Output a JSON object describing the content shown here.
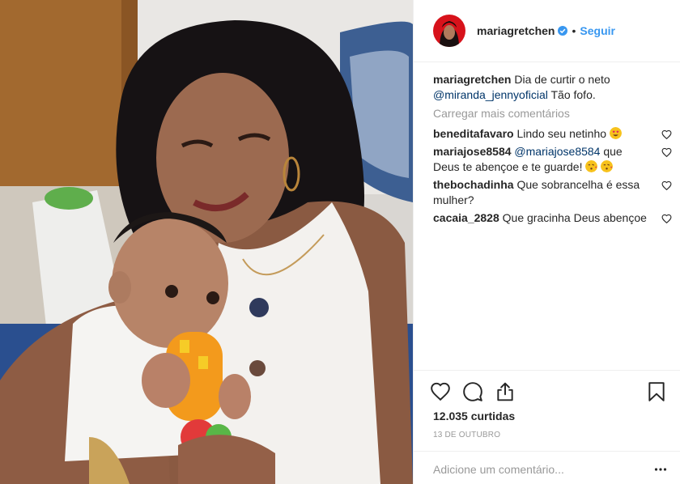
{
  "post": {
    "photo_alt": "",
    "author": {
      "username": "mariagretchen",
      "verified": true,
      "follow_label": "Seguir",
      "separator": "•"
    },
    "caption": {
      "username": "mariagretchen",
      "text_before": "Dia de curtir o neto",
      "mention": "@miranda_jennyoficial",
      "text_after": "Tão fofo."
    },
    "load_more_label": "Carregar mais comentários",
    "comments": [
      {
        "username": "beneditafavaro",
        "text": "Lindo seu netinho",
        "emoji": [
          "heart-eyes"
        ]
      },
      {
        "username": "mariajose8584",
        "mention": "@mariajose8584",
        "text": "que Deus te abençoe e te guarde!",
        "emoji": [
          "kiss",
          "kiss"
        ]
      },
      {
        "username": "thebochadinha",
        "text": "Que sobrancelha é essa mulher?",
        "emoji": []
      },
      {
        "username": "cacaia_2828",
        "text": "Que gracinha Deus abençoe",
        "emoji": []
      }
    ],
    "likes_label": "12.035 curtidas",
    "date_label": "13 de outubro",
    "comment_placeholder": "Adicione um comentário...",
    "colors": {
      "link": "#3897f0",
      "mention": "#003569",
      "muted": "#999999",
      "text": "#262626",
      "verified": "#3897f0"
    },
    "icons": [
      "heart-icon",
      "comment-icon",
      "share-icon",
      "bookmark-icon",
      "more-options-icon",
      "verified-badge-icon"
    ]
  }
}
